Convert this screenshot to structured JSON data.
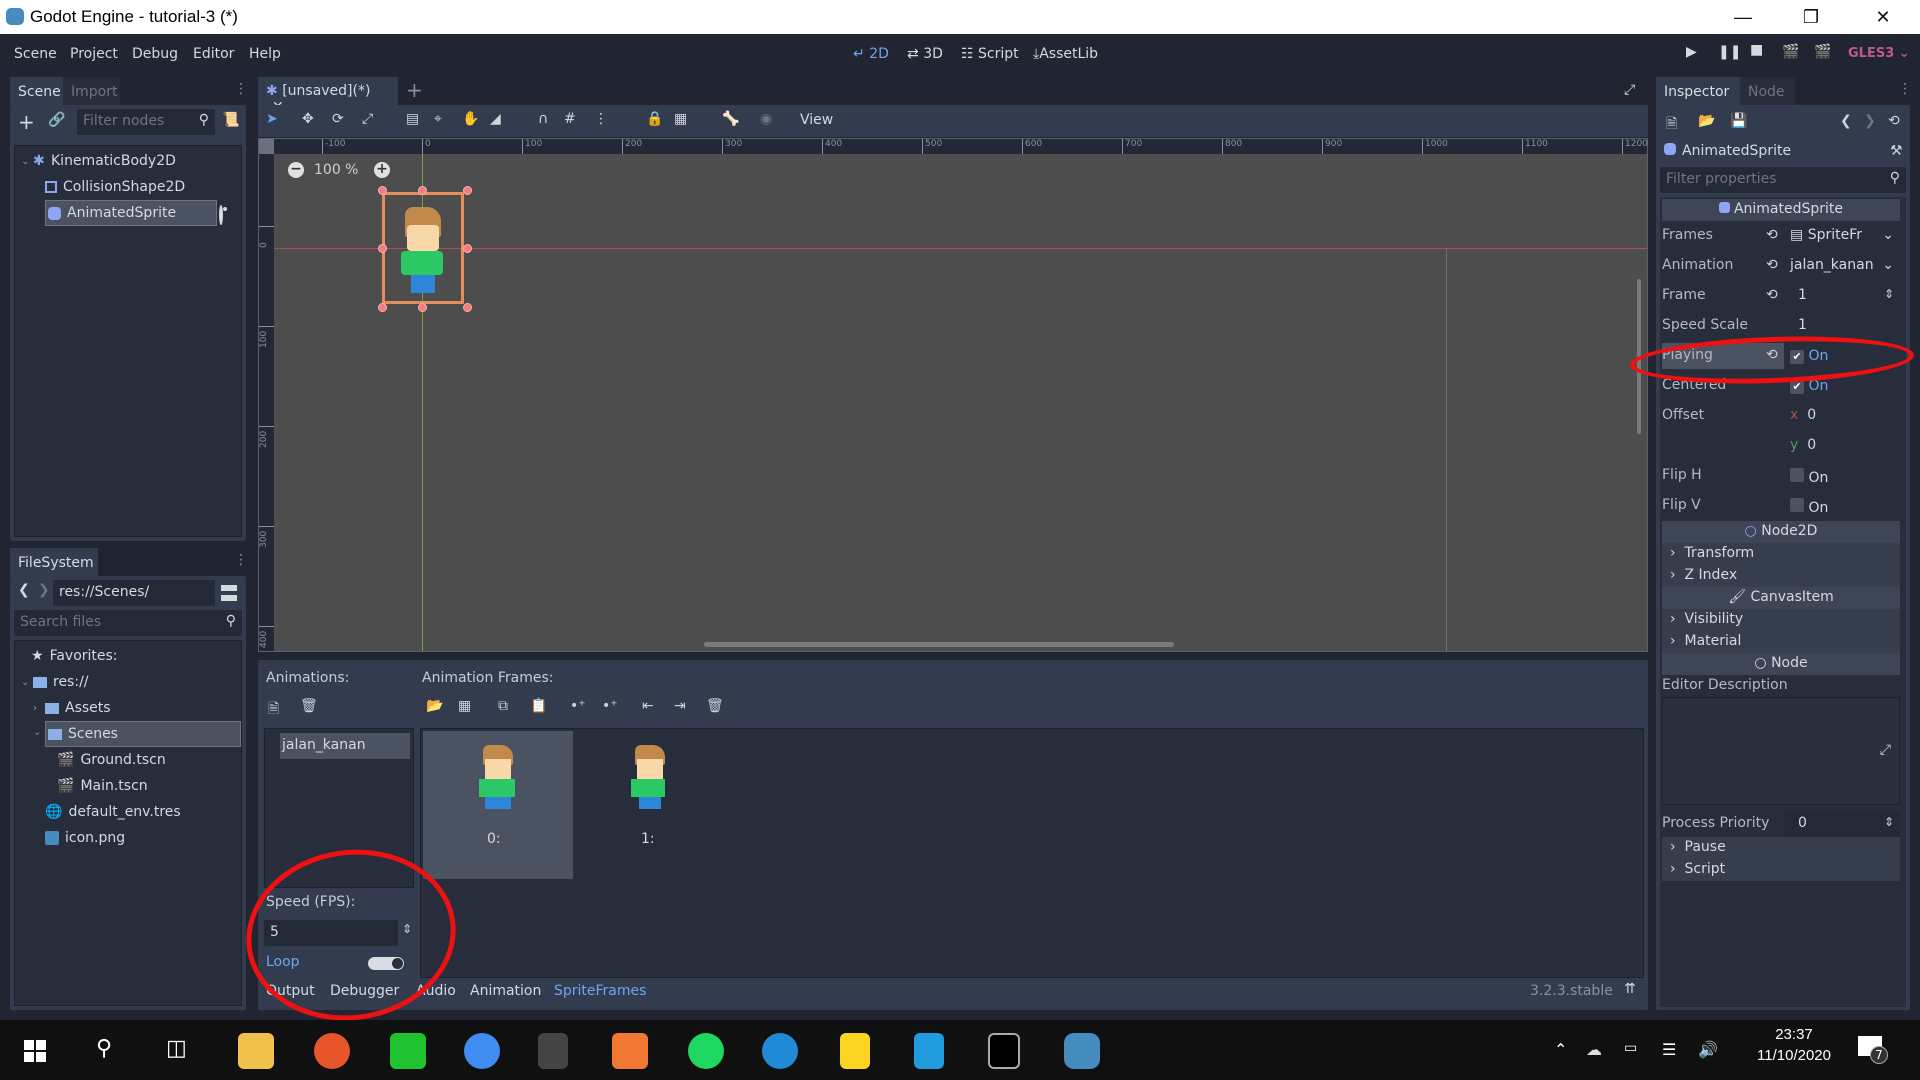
{
  "window": {
    "title": "Godot Engine - tutorial-3 (*)",
    "minimize_icon": "minimize-icon",
    "restore_icon": "restore-icon",
    "close_icon": "close-icon"
  },
  "menu": [
    "Scene",
    "Project",
    "Debug",
    "Editor",
    "Help"
  ],
  "workspaces": [
    {
      "label": "2D",
      "active": true
    },
    {
      "label": "3D"
    },
    {
      "label": "Script"
    },
    {
      "label": "AssetLib"
    }
  ],
  "run_controls": {
    "renderer": "GLES3"
  },
  "scene_dock": {
    "tabs": [
      "Scene",
      "Import"
    ],
    "filter_placeholder": "Filter nodes",
    "nodes": [
      {
        "name": "KinematicBody2D",
        "icon": "kinematic-body-icon",
        "depth": 0
      },
      {
        "name": "CollisionShape2D",
        "icon": "collision-shape-icon",
        "depth": 1
      },
      {
        "name": "AnimatedSprite",
        "icon": "animated-sprite-icon",
        "depth": 1,
        "selected": true
      }
    ]
  },
  "filesystem_dock": {
    "tab": "FileSystem",
    "path": "res://Scenes/",
    "search_placeholder": "Search files",
    "favorites": "Favorites:",
    "items": [
      {
        "name": "res://",
        "icon": "folder-icon",
        "depth": 0
      },
      {
        "name": "Assets",
        "icon": "folder-icon",
        "depth": 1
      },
      {
        "name": "Scenes",
        "icon": "folder-icon",
        "depth": 1,
        "selected": true
      },
      {
        "name": "Ground.tscn",
        "icon": "scene-file-icon",
        "depth": 2
      },
      {
        "name": "Main.tscn",
        "icon": "scene-file-icon",
        "depth": 2
      },
      {
        "name": "default_env.tres",
        "icon": "environment-icon",
        "depth": 1
      },
      {
        "name": "icon.png",
        "icon": "image-icon",
        "depth": 1
      }
    ]
  },
  "editor": {
    "scene_tab": "[unsaved](*)",
    "view_menu": "View",
    "zoom": "100 %",
    "ruler_h": [
      "-100",
      "0",
      "100",
      "200",
      "300",
      "400",
      "500",
      "600",
      "700",
      "800",
      "900",
      "1000",
      "1100",
      "1200"
    ],
    "ruler_v": [
      "0",
      "100",
      "200",
      "300",
      "400"
    ]
  },
  "spriteframes": {
    "animations_label": "Animations:",
    "frames_label": "Animation Frames:",
    "animations": [
      "jalan_kanan"
    ],
    "frames": [
      "0:",
      "1:"
    ],
    "speed_label": "Speed (FPS):",
    "speed": "5",
    "loop_label": "Loop",
    "loop": true
  },
  "bottom_tabs": [
    "Output",
    "Debugger",
    "Audio",
    "Animation",
    "SpriteFrames"
  ],
  "active_bottom_tab": "SpriteFrames",
  "version": "3.2.3.stable",
  "inspector": {
    "tabs": [
      "Inspector",
      "Node"
    ],
    "object": "AnimatedSprite",
    "filter_placeholder": "Filter properties",
    "class_header": "AnimatedSprite",
    "props": {
      "frames": {
        "label": "Frames",
        "value": "SpriteFr"
      },
      "animation": {
        "label": "Animation",
        "value": "jalan_kanan"
      },
      "frame": {
        "label": "Frame",
        "value": "1"
      },
      "speed_scale": {
        "label": "Speed Scale",
        "value": "1"
      },
      "playing": {
        "label": "Playing",
        "value": "On",
        "checked": true
      },
      "centered": {
        "label": "Centered",
        "value": "On",
        "checked": true
      },
      "offset": {
        "label": "Offset",
        "x": "0",
        "y": "0"
      },
      "flip_h": {
        "label": "Flip H",
        "value": "On",
        "checked": false
      },
      "flip_v": {
        "label": "Flip V",
        "value": "On",
        "checked": false
      }
    },
    "node2d_header": "Node2D",
    "node2d_groups": [
      "Transform",
      "Z Index"
    ],
    "canvasitem_header": "CanvasItem",
    "canvasitem_groups": [
      "Visibility",
      "Material"
    ],
    "node_header": "Node",
    "editor_description": "Editor Description",
    "process_priority": {
      "label": "Process Priority",
      "value": "0"
    },
    "node_groups": [
      "Pause",
      "Script"
    ]
  },
  "taskbar": {
    "apps": [
      "windows-start",
      "search",
      "task-view",
      "file-explorer",
      "firefox",
      "line",
      "zoom",
      "sublime-text",
      "xampp",
      "spotify",
      "edge",
      "sticky-notes",
      "vscode",
      "terminal",
      "godot"
    ],
    "time": "23:37",
    "date": "11/10/2020",
    "notifications": "7"
  }
}
